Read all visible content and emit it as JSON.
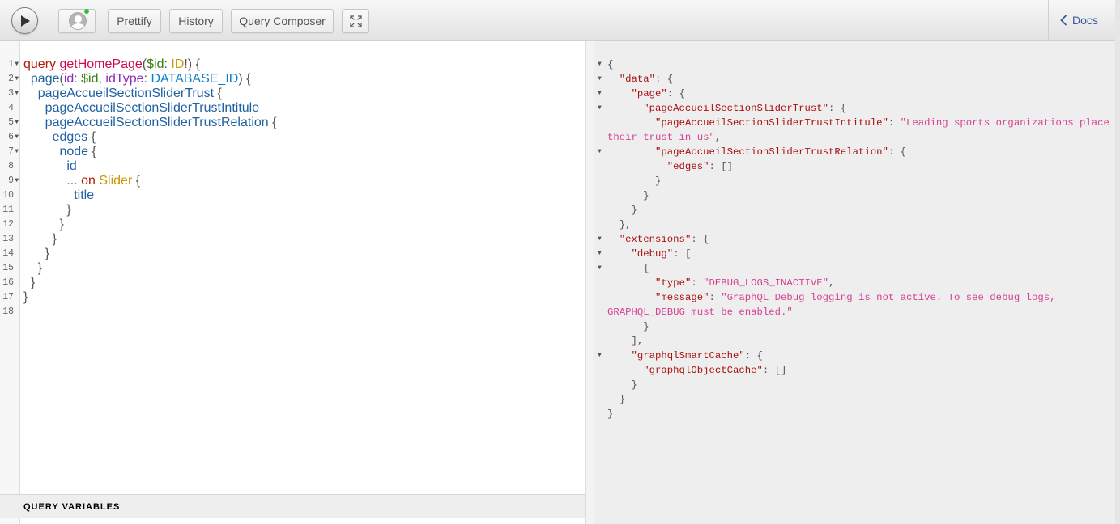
{
  "toolbar": {
    "execute_label": "",
    "prettify_label": "Prettify",
    "history_label": "History",
    "composer_label": "Query Composer",
    "docs_label": "Docs",
    "online_status_color": "#2bbd3a"
  },
  "editor": {
    "line_numbers": [
      "1",
      "2",
      "3",
      "4",
      "5",
      "6",
      "7",
      "8",
      "9",
      "10",
      "11",
      "12",
      "13",
      "14",
      "15",
      "16",
      "17",
      "18"
    ],
    "fold_lines": [
      1,
      2,
      3,
      5,
      6,
      7,
      9
    ],
    "lines": [
      [
        [
          "kw",
          "query"
        ],
        [
          "plain",
          " "
        ],
        [
          "def",
          "getHomePage"
        ],
        [
          "punc",
          "("
        ],
        [
          "var",
          "$id"
        ],
        [
          "punc",
          ": "
        ],
        [
          "type",
          "ID"
        ],
        [
          "punc",
          "!) {"
        ]
      ],
      [
        [
          "plain",
          "  "
        ],
        [
          "field",
          "page"
        ],
        [
          "punc",
          "("
        ],
        [
          "attr",
          "id"
        ],
        [
          "punc",
          ": "
        ],
        [
          "var",
          "$id"
        ],
        [
          "punc",
          ", "
        ],
        [
          "attr",
          "idType"
        ],
        [
          "punc",
          ": "
        ],
        [
          "enum",
          "DATABASE_ID"
        ],
        [
          "punc",
          ") {"
        ]
      ],
      [
        [
          "plain",
          "    "
        ],
        [
          "field",
          "pageAccueilSectionSliderTrust"
        ],
        [
          "punc",
          " {"
        ]
      ],
      [
        [
          "plain",
          "      "
        ],
        [
          "field",
          "pageAccueilSectionSliderTrustIntitule"
        ]
      ],
      [
        [
          "plain",
          "      "
        ],
        [
          "field",
          "pageAccueilSectionSliderTrustRelation"
        ],
        [
          "punc",
          " {"
        ]
      ],
      [
        [
          "plain",
          "        "
        ],
        [
          "field",
          "edges"
        ],
        [
          "punc",
          " {"
        ]
      ],
      [
        [
          "plain",
          "          "
        ],
        [
          "field",
          "node"
        ],
        [
          "punc",
          " {"
        ]
      ],
      [
        [
          "plain",
          "            "
        ],
        [
          "field",
          "id"
        ]
      ],
      [
        [
          "plain",
          "            "
        ],
        [
          "punc",
          "... "
        ],
        [
          "kw",
          "on"
        ],
        [
          "plain",
          " "
        ],
        [
          "type",
          "Slider"
        ],
        [
          "punc",
          " {"
        ]
      ],
      [
        [
          "plain",
          "              "
        ],
        [
          "field",
          "title"
        ]
      ],
      [
        [
          "plain",
          "            "
        ],
        [
          "punc",
          "}"
        ]
      ],
      [
        [
          "plain",
          "          "
        ],
        [
          "punc",
          "}"
        ]
      ],
      [
        [
          "plain",
          "        "
        ],
        [
          "punc",
          "}"
        ]
      ],
      [
        [
          "plain",
          "      "
        ],
        [
          "punc",
          "}"
        ]
      ],
      [
        [
          "plain",
          "    "
        ],
        [
          "punc",
          "}"
        ]
      ],
      [
        [
          "plain",
          "  "
        ],
        [
          "punc",
          "}"
        ]
      ],
      [
        [
          "punc",
          "}"
        ]
      ],
      []
    ]
  },
  "query_variables": {
    "title": "QUERY VARIABLES"
  },
  "result": {
    "fold_lines": [
      0,
      1,
      2,
      3,
      5,
      12,
      13,
      14,
      22
    ],
    "lines": [
      [
        [
          "p",
          "{"
        ]
      ],
      [
        [
          "p",
          "  "
        ],
        [
          "k",
          "\"data\""
        ],
        [
          "p",
          ": {"
        ]
      ],
      [
        [
          "p",
          "    "
        ],
        [
          "k",
          "\"page\""
        ],
        [
          "p",
          ": {"
        ]
      ],
      [
        [
          "p",
          "      "
        ],
        [
          "k",
          "\"pageAccueilSectionSliderTrust\""
        ],
        [
          "p",
          ": {"
        ]
      ],
      [
        [
          "p",
          "        "
        ],
        [
          "k",
          "\"pageAccueilSectionSliderTrustIntitule\""
        ],
        [
          "p",
          ": "
        ],
        [
          "s",
          "\"Leading sports organizations place"
        ]
      ],
      [
        [
          "s",
          "their trust in us\""
        ],
        [
          "p",
          ","
        ]
      ],
      [
        [
          "p",
          "        "
        ],
        [
          "k",
          "\"pageAccueilSectionSliderTrustRelation\""
        ],
        [
          "p",
          ": {"
        ]
      ],
      [
        [
          "p",
          "          "
        ],
        [
          "k",
          "\"edges\""
        ],
        [
          "p",
          ": []"
        ]
      ],
      [
        [
          "p",
          "        }"
        ]
      ],
      [
        [
          "p",
          "      }"
        ]
      ],
      [
        [
          "p",
          "    }"
        ]
      ],
      [
        [
          "p",
          "  },"
        ]
      ],
      [
        [
          "p",
          "  "
        ],
        [
          "k",
          "\"extensions\""
        ],
        [
          "p",
          ": {"
        ]
      ],
      [
        [
          "p",
          "    "
        ],
        [
          "k",
          "\"debug\""
        ],
        [
          "p",
          ": ["
        ]
      ],
      [
        [
          "p",
          "      {"
        ]
      ],
      [
        [
          "p",
          "        "
        ],
        [
          "k",
          "\"type\""
        ],
        [
          "p",
          ": "
        ],
        [
          "s",
          "\"DEBUG_LOGS_INACTIVE\""
        ],
        [
          "p",
          ","
        ]
      ],
      [
        [
          "p",
          "        "
        ],
        [
          "k",
          "\"message\""
        ],
        [
          "p",
          ": "
        ],
        [
          "s",
          "\"GraphQL Debug logging is not active. To see debug logs,"
        ]
      ],
      [
        [
          "s",
          "GRAPHQL_DEBUG must be enabled.\""
        ]
      ],
      [
        [
          "p",
          "      }"
        ]
      ],
      [
        [
          "p",
          "    ],"
        ]
      ],
      [
        [
          "p",
          "    "
        ],
        [
          "k",
          "\"graphqlSmartCache\""
        ],
        [
          "p",
          ": {"
        ]
      ],
      [
        [
          "p",
          "      "
        ],
        [
          "k",
          "\"graphqlObjectCache\""
        ],
        [
          "p",
          ": []"
        ]
      ],
      [
        [
          "p",
          "    }"
        ]
      ],
      [
        [
          "p",
          "  }"
        ]
      ],
      [
        [
          "p",
          "}"
        ]
      ]
    ],
    "fold_rows": [
      0,
      1,
      2,
      3,
      6,
      12,
      13,
      14,
      20
    ]
  }
}
